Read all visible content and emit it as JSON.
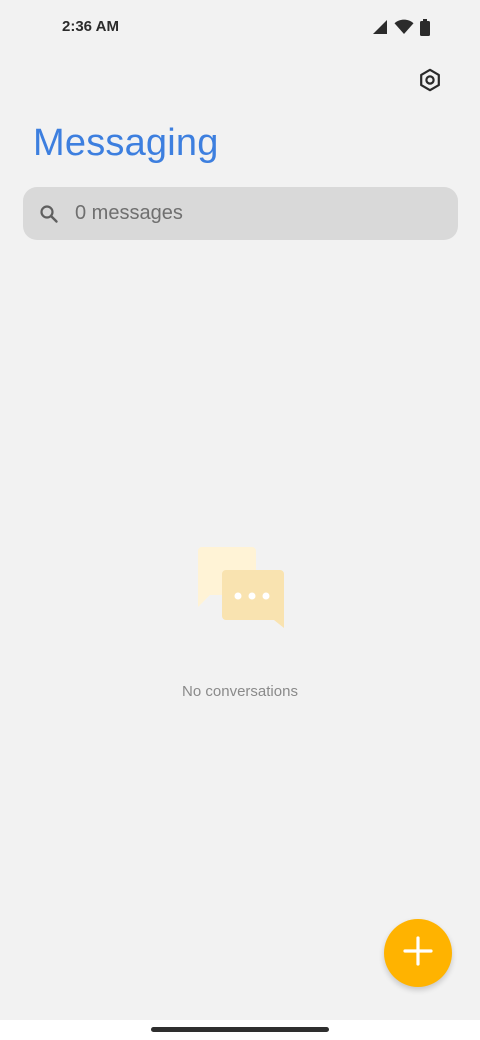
{
  "status_bar": {
    "time": "2:36 AM",
    "icons": [
      "cellular-signal-icon",
      "wifi-icon",
      "battery-icon"
    ]
  },
  "header": {
    "title": "Messaging",
    "settings_icon": "settings-icon"
  },
  "search": {
    "placeholder": "0 messages",
    "icon": "search-icon"
  },
  "empty_state": {
    "illustration": "chat-bubbles-icon",
    "text": "No conversations"
  },
  "fab": {
    "icon": "plus-icon"
  },
  "colors": {
    "background": "#f2f2f2",
    "title": "#3d7fdf",
    "search_bg": "#d9d9d9",
    "fab": "#ffb300",
    "illustration_light": "#fff3d6",
    "illustration_dark": "#f9e3b0"
  }
}
